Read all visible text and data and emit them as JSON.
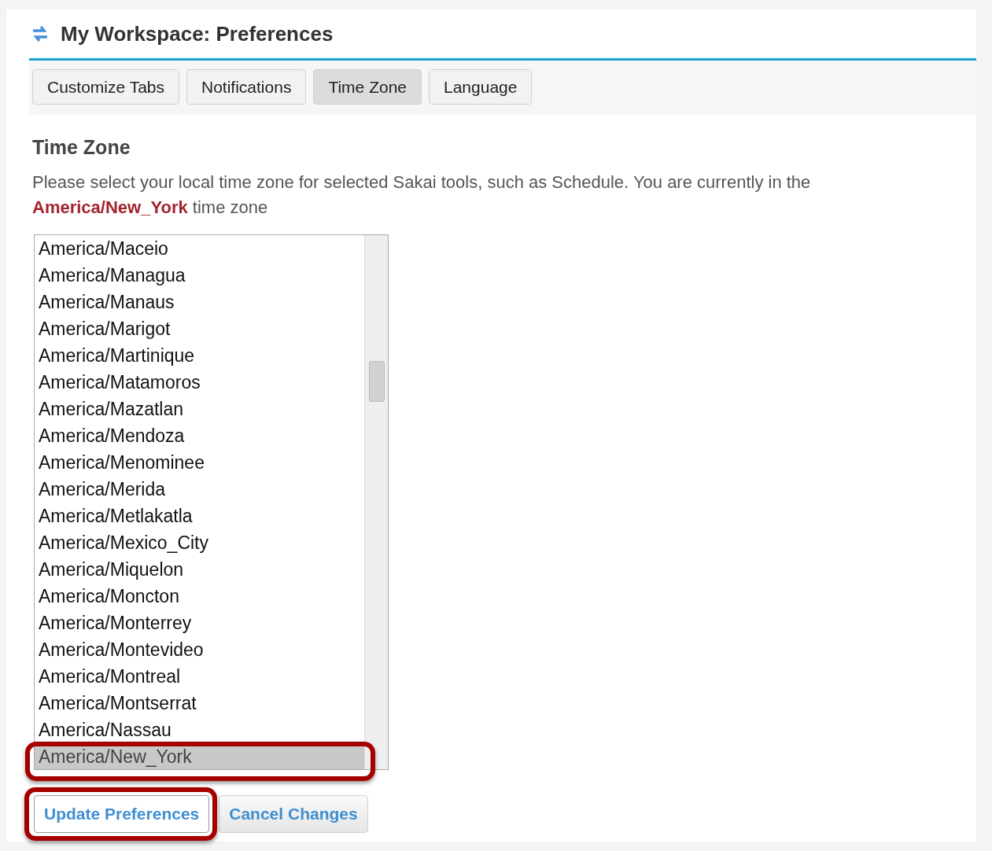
{
  "header": {
    "title": "My Workspace: Preferences"
  },
  "tabs": [
    {
      "label": "Customize Tabs",
      "selected": false
    },
    {
      "label": "Notifications",
      "selected": false
    },
    {
      "label": "Time Zone",
      "selected": true
    },
    {
      "label": "Language",
      "selected": false
    }
  ],
  "section": {
    "heading": "Time Zone",
    "text": "Please select your local time zone for selected Sakai tools, such as Schedule. You are currently in the",
    "current_zone": "America/New_York",
    "text_end": "time zone"
  },
  "time_zones": [
    {
      "label": "America/Maceio",
      "selected": false
    },
    {
      "label": "America/Managua",
      "selected": false
    },
    {
      "label": "America/Manaus",
      "selected": false
    },
    {
      "label": "America/Marigot",
      "selected": false
    },
    {
      "label": "America/Martinique",
      "selected": false
    },
    {
      "label": "America/Matamoros",
      "selected": false
    },
    {
      "label": "America/Mazatlan",
      "selected": false
    },
    {
      "label": "America/Mendoza",
      "selected": false
    },
    {
      "label": "America/Menominee",
      "selected": false
    },
    {
      "label": "America/Merida",
      "selected": false
    },
    {
      "label": "America/Metlakatla",
      "selected": false
    },
    {
      "label": "America/Mexico_City",
      "selected": false
    },
    {
      "label": "America/Miquelon",
      "selected": false
    },
    {
      "label": "America/Moncton",
      "selected": false
    },
    {
      "label": "America/Monterrey",
      "selected": false
    },
    {
      "label": "America/Montevideo",
      "selected": false
    },
    {
      "label": "America/Montreal",
      "selected": false
    },
    {
      "label": "America/Montserrat",
      "selected": false
    },
    {
      "label": "America/Nassau",
      "selected": false
    },
    {
      "label": "America/New_York",
      "selected": true
    }
  ],
  "buttons": [
    {
      "label": "Update Preferences",
      "highlighted": true
    },
    {
      "label": "Cancel Changes",
      "highlighted": false
    }
  ]
}
